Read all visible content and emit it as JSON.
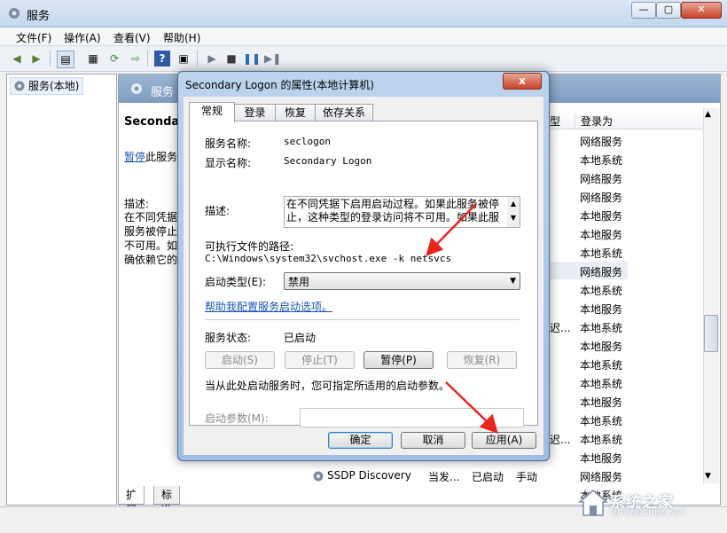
{
  "window": {
    "title": "服务"
  },
  "menu": [
    {
      "label": "文件(F)"
    },
    {
      "label": "操作(A)"
    },
    {
      "label": "查看(V)"
    },
    {
      "label": "帮助(H)"
    }
  ],
  "tree": {
    "root_label": "服务(本地)"
  },
  "content": {
    "header": "服务",
    "detail_title": "Secondary",
    "action_link": "暂停",
    "action_suffix": "此服务",
    "desc_label": "描述:",
    "desc_lines": [
      "在不同凭据",
      "服务被停止",
      "不可用。如",
      "确依赖它的"
    ],
    "col_type": "型",
    "col_logon": "登录为",
    "logon_values": [
      "网络服务",
      "本地系统",
      "网络服务",
      "网络服务",
      "本地服务",
      "本地服务",
      "本地系统",
      "网络服务",
      "本地系统",
      "本地服务",
      "本地系统",
      "本地服务",
      "本地系统",
      "本地系统",
      "本地服务",
      "本地系统",
      "本地系统",
      "本地服务",
      "网络服务",
      "本地系统"
    ],
    "ssdp": {
      "name": "SSDP Discovery",
      "desc": "当发...",
      "status": "已启动",
      "startup": "手动"
    },
    "fragment_texts": [
      "迟...",
      "迟...",
      "迟..."
    ],
    "bottom_tabs": [
      "扩展",
      "标准"
    ]
  },
  "dialog": {
    "title": "Secondary Logon 的属性(本地计算机)",
    "close": "x",
    "tabs": [
      "常规",
      "登录",
      "恢复",
      "依存关系"
    ],
    "service_name_label": "服务名称:",
    "service_name_value": "seclogon",
    "display_name_label": "显示名称:",
    "display_name_value": "Secondary Logon",
    "description_label": "描述:",
    "description_lines": [
      "在不同凭据下启用启动过程。如果此服务被停",
      "止，这种类型的登录访问将不可用。如果此服"
    ],
    "path_label": "可执行文件的路径:",
    "path_value": "C:\\Windows\\system32\\svchost.exe -k netsvcs",
    "startup_type_label": "启动类型(E):",
    "startup_type_value": "禁用",
    "help_link": "帮助我配置服务启动选项。",
    "status_label": "服务状态:",
    "status_value": "已启动",
    "buttons": {
      "start": "启动(S)",
      "stop": "停止(T)",
      "pause": "暂停(P)",
      "resume": "恢复(R)",
      "ok": "确定",
      "cancel": "取消",
      "apply": "应用(A)"
    },
    "hint": "当从此处启动服务时，您可指定所适用的启动参数。",
    "params_label": "启动参数(M):",
    "params_value": ""
  },
  "watermark": {
    "text": "系统之家",
    "sub": "XITONGZHIJIA.NET"
  },
  "colors": {
    "accent": "#1a55b5",
    "arrow": "#e8261e",
    "titlebar": "#c4d7ee"
  }
}
